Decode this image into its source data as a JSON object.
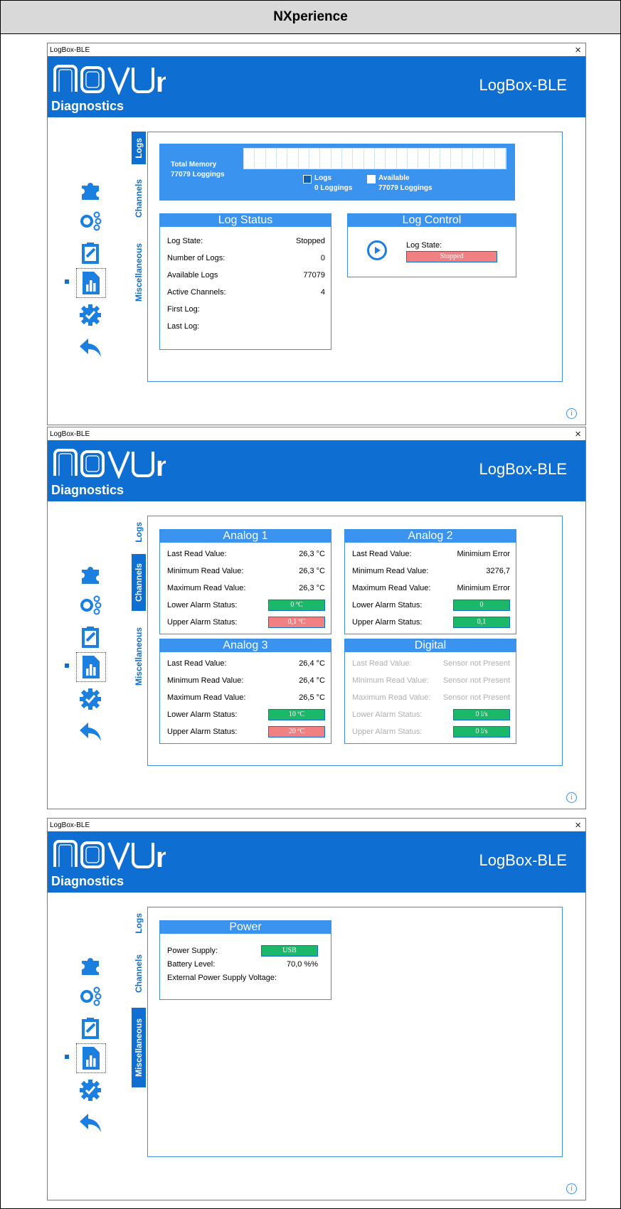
{
  "doc_title": "NXperience",
  "window": {
    "title": "LogBox-BLE",
    "brand": "novus",
    "subtitle": "Diagnostics",
    "product": "LogBox-BLE",
    "close": "×",
    "info": "i"
  },
  "sidebar_icons": [
    "puzzle-icon",
    "channels-icon",
    "clipboard-icon",
    "diagnostics-icon",
    "settings-icon",
    "back-icon"
  ],
  "tabs": {
    "logs": "Logs",
    "channels": "Channels",
    "misc": "Miscellaneous"
  },
  "logs": {
    "memory": {
      "title": "Total Memory",
      "total": "77079 Loggings",
      "logs_label": "Logs",
      "logs_value": "0 Loggings",
      "avail_label": "Available",
      "avail_value": "77079 Loggings",
      "used_fraction": 0
    },
    "status": {
      "title": "Log Status",
      "rows": [
        {
          "label": "Log State:",
          "value": "Stopped"
        },
        {
          "label": "Number of Logs:",
          "value": "0"
        },
        {
          "label": "Available Logs",
          "value": "77079"
        },
        {
          "label": "Active Channels:",
          "value": "4"
        },
        {
          "label": "First Log:",
          "value": ""
        },
        {
          "label": "Last Log:",
          "value": ""
        }
      ]
    },
    "control": {
      "title": "Log Control",
      "state_label": "Log State:",
      "state_value": "Stopped"
    }
  },
  "channels": {
    "analog1": {
      "title": "Analog 1",
      "rows": [
        {
          "label": "Last Read Value:",
          "value": "26,3 °C"
        },
        {
          "label": "Minimum Read Value:",
          "value": "26,3 °C"
        },
        {
          "label": "Maximum Read Value:",
          "value": "26,3 °C"
        },
        {
          "label": "Lower Alarm Status:",
          "value": "0 ºC",
          "color": "green"
        },
        {
          "label": "Upper Alarm Status:",
          "value": "0,1 ºC",
          "color": "red"
        }
      ]
    },
    "analog2": {
      "title": "Analog 2",
      "rows": [
        {
          "label": "Last Read Value:",
          "value": "Minimium Error"
        },
        {
          "label": "Minimum Read Value:",
          "value": "3276,7"
        },
        {
          "label": "Maximum Read Value:",
          "value": "Minimium Error"
        },
        {
          "label": "Lower Alarm Status:",
          "value": "0",
          "color": "green"
        },
        {
          "label": "Upper Alarm Status:",
          "value": "0,1",
          "color": "green"
        }
      ]
    },
    "analog3": {
      "title": "Analog 3",
      "rows": [
        {
          "label": "Last Read Value:",
          "value": "26,4 °C"
        },
        {
          "label": "Minimum Read Value:",
          "value": "26,4 °C"
        },
        {
          "label": "Maximum Read Value:",
          "value": "26,5 °C"
        },
        {
          "label": "Lower Alarm Status:",
          "value": "10 ºC",
          "color": "green"
        },
        {
          "label": "Upper Alarm Status:",
          "value": "20 ºC",
          "color": "red"
        }
      ]
    },
    "digital": {
      "title": "Digital",
      "rows": [
        {
          "label": "Last Read Value:",
          "value": "Sensor not Present"
        },
        {
          "label": "Minimum Read Value:",
          "value": "Sensor not Present"
        },
        {
          "label": "Maximum Read Value:",
          "value": "Sensor not Present"
        },
        {
          "label": "Lower Alarm Status:",
          "value": "0 l/s",
          "color": "green"
        },
        {
          "label": "Upper Alarm Status:",
          "value": "0 l/s",
          "color": "green"
        }
      ]
    }
  },
  "misc": {
    "power": {
      "title": "Power",
      "supply_label": "Power Supply:",
      "supply_value": "USB",
      "battery_label": "Battery Level:",
      "battery_value": "70,0 %%",
      "ext_label": "External Power Supply Voltage:",
      "ext_value": ""
    }
  },
  "colors": {
    "brand_blue": "#0f6ed1",
    "card_header": "#3a93ee",
    "ok_green": "#1cb86a",
    "alarm_red": "#f08082"
  }
}
